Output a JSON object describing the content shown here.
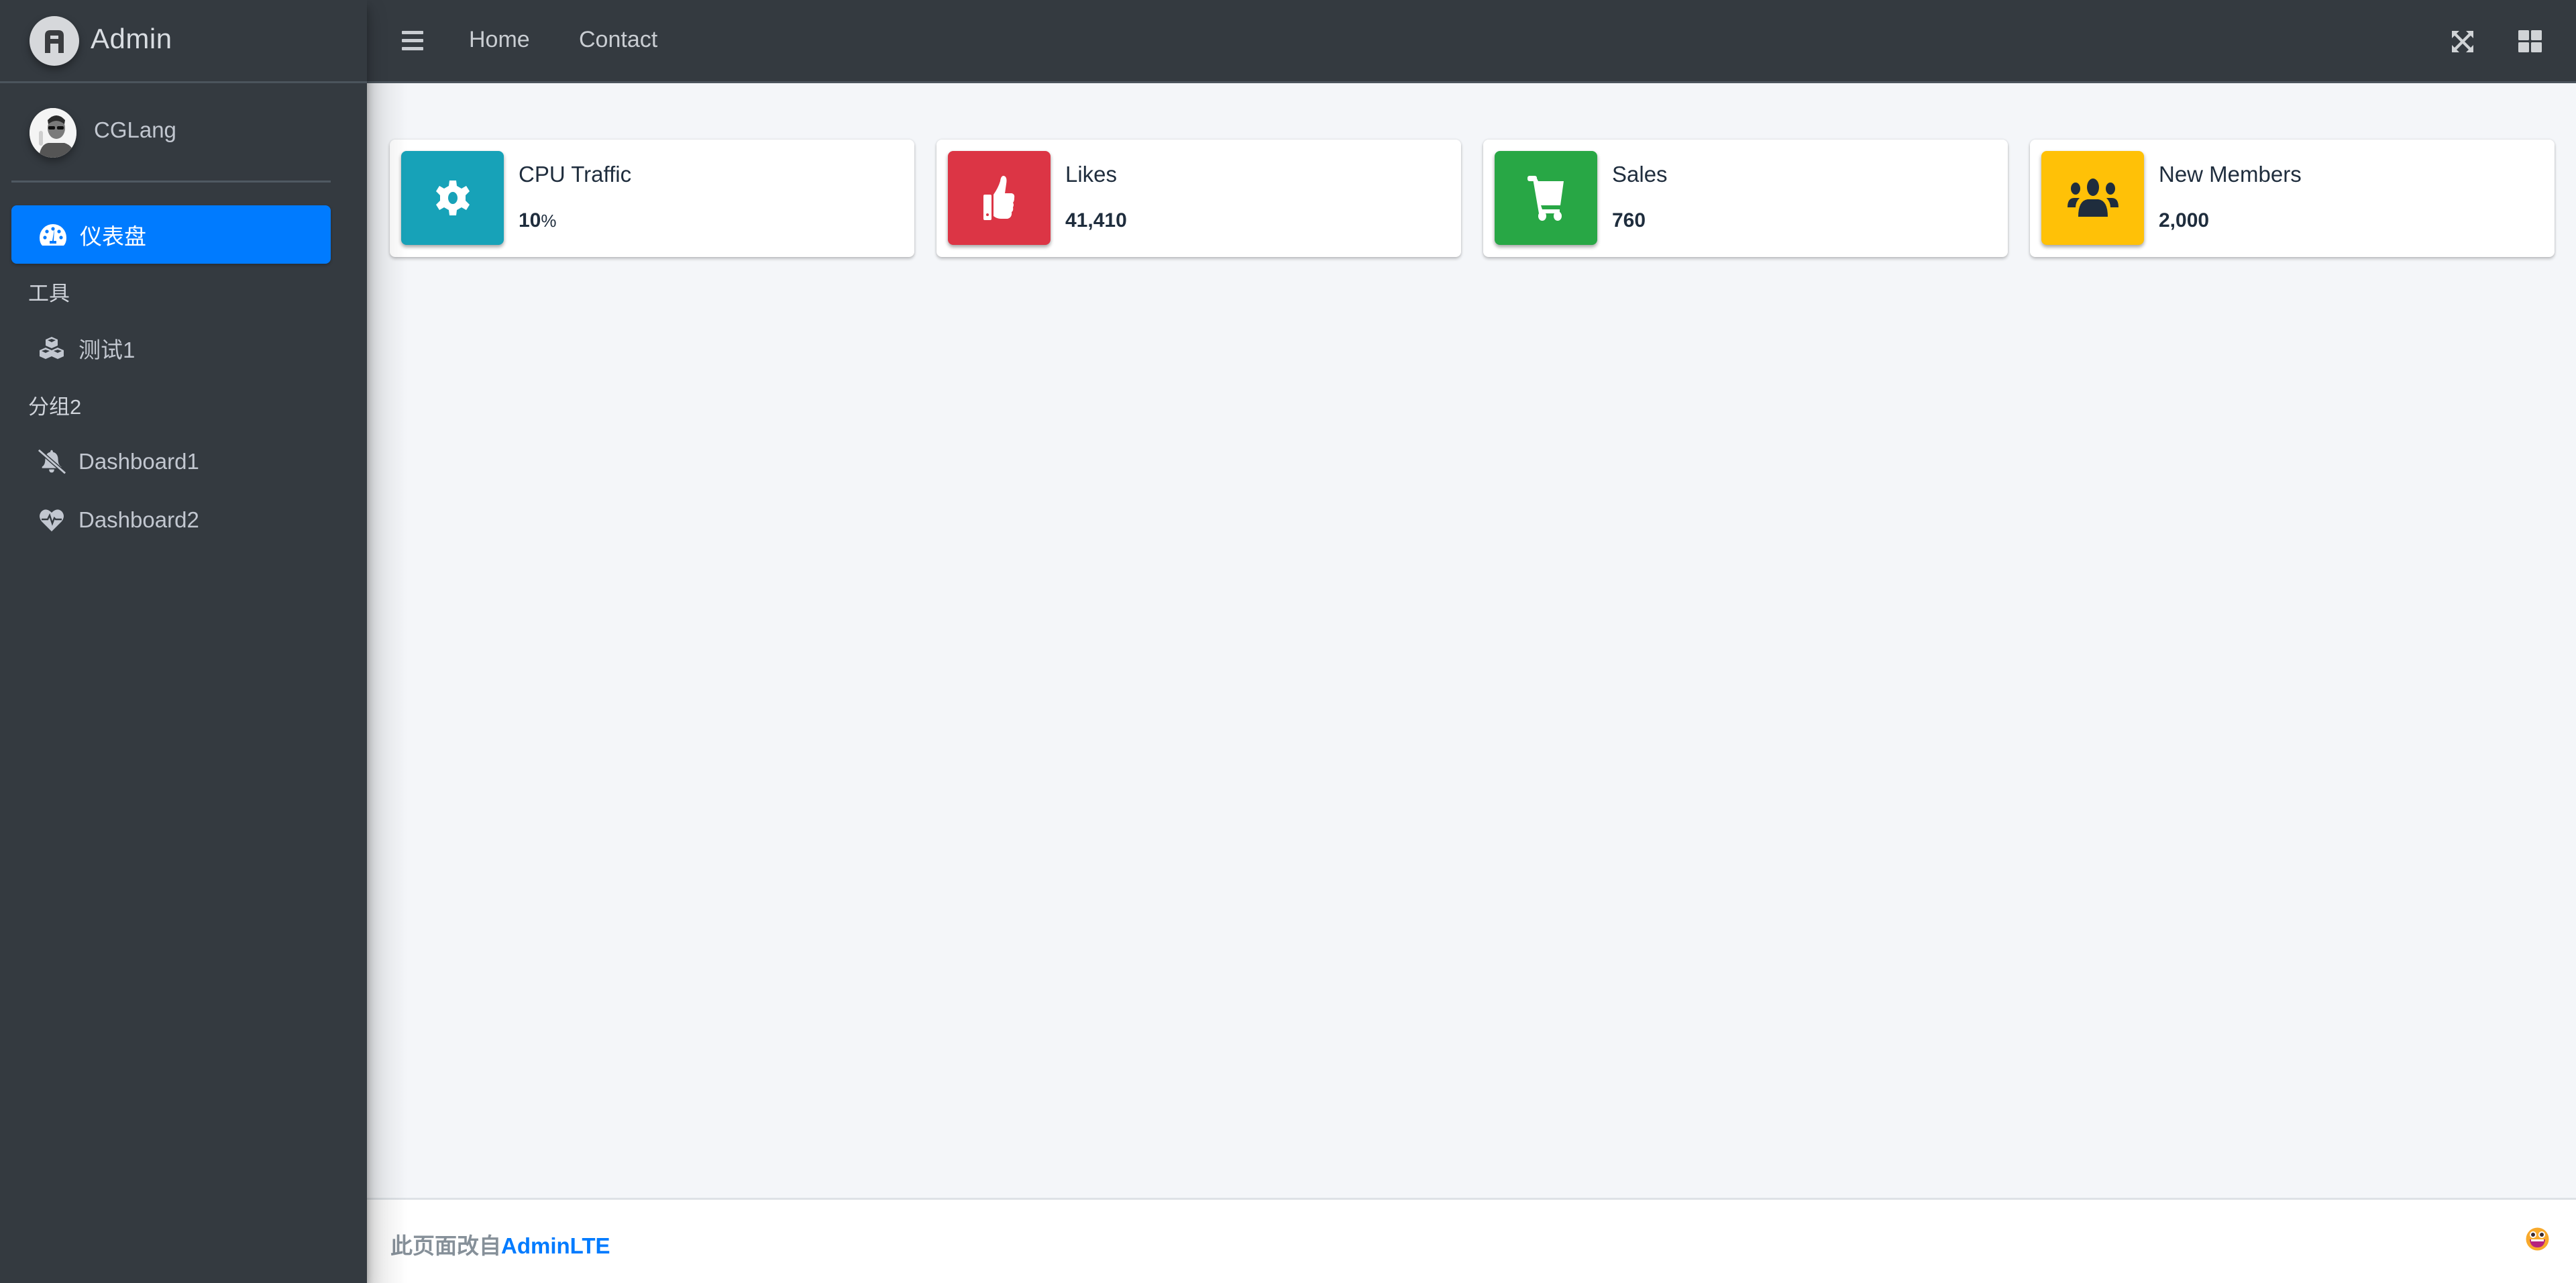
{
  "brand": {
    "title": "Admin",
    "logo_icon": "admin-logo-icon"
  },
  "user": {
    "name": "CGLang",
    "avatar": "user-avatar"
  },
  "sidebar": {
    "active_item": {
      "label": "仪表盘",
      "icon": "tachometer-icon"
    },
    "groups": [
      {
        "header": "工具",
        "items": [
          {
            "label": "测试1",
            "icon": "cubes-icon"
          }
        ]
      },
      {
        "header": "分组2",
        "items": [
          {
            "label": "Dashboard1",
            "icon": "bell-slash-icon"
          },
          {
            "label": "Dashboard2",
            "icon": "heartbeat-icon"
          }
        ]
      }
    ]
  },
  "topbar": {
    "menu_icon": "bars-icon",
    "links": [
      {
        "label": "Home"
      },
      {
        "label": "Contact"
      }
    ],
    "right_icons": [
      "expand-arrows-icon",
      "th-large-icon"
    ]
  },
  "info_boxes": [
    {
      "label": "CPU Traffic",
      "value": "10",
      "unit": "%",
      "icon": "cog-icon",
      "color": "#17a2b8"
    },
    {
      "label": "Likes",
      "value": "41,410",
      "unit": "",
      "icon": "thumbs-up-icon",
      "color": "#dc3545"
    },
    {
      "label": "Sales",
      "value": "760",
      "unit": "",
      "icon": "shopping-cart-icon",
      "color": "#28a745"
    },
    {
      "label": "New Members",
      "value": "2,000",
      "unit": "",
      "icon": "users-icon",
      "color": "#ffc107"
    }
  ],
  "footer": {
    "text": "此页面改自",
    "link_label": "AdminLTE",
    "emoji_icon": "grinning-face-icon"
  },
  "colors": {
    "sidebar_bg": "#343a40",
    "accent": "#007bff",
    "content_bg": "#f4f6f9"
  }
}
